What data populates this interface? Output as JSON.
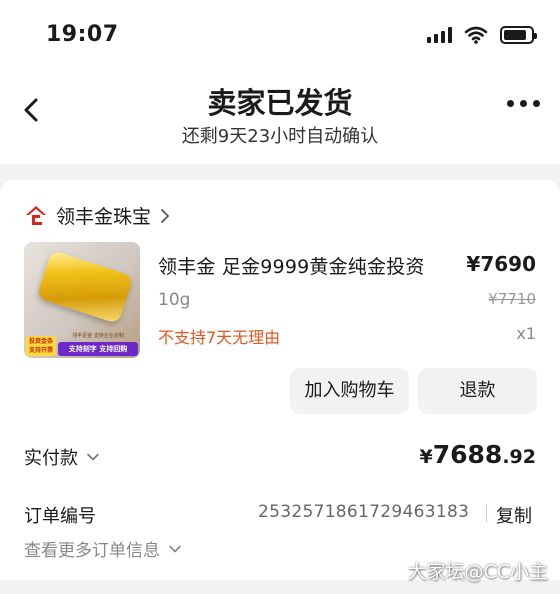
{
  "status_bar": {
    "time": "19:07",
    "battery_level": 0.85
  },
  "nav": {
    "title": "卖家已发货",
    "subtitle": "还剩9天23小时自动确认"
  },
  "shop": {
    "logo_text": "企",
    "name": "领丰金珠宝",
    "chevron": "〉",
    "logo_color": "#d7261e"
  },
  "product": {
    "name": "领丰金 足金9999黄金纯金投资",
    "price": "¥7690",
    "spec": "10g",
    "original_price": "¥7710",
    "notice": "不支持7天无理由",
    "quantity": "x1",
    "thumb_tag_1": "投资金条\n支持开票",
    "thumb_tag_2_top": "翎丰足金 支持企业定制",
    "thumb_tag_2": "支持刻字 支持回购"
  },
  "actions": {
    "add_to_cart": "加入购物车",
    "refund": "退款"
  },
  "payment": {
    "label": "实付款",
    "symbol": "¥",
    "amount_int": "7688",
    "amount_dec": ".92"
  },
  "order": {
    "label": "订单编号",
    "number": "2532571861729463183",
    "copy": "复制",
    "more_info": "查看更多订单信息"
  },
  "watermark": "大家坛@CC小主",
  "colors": {
    "warning": "#e2581f",
    "button_bg": "#f2f2f2",
    "page_bg": "#f2f2f2"
  },
  "icons": [
    "back-icon",
    "more-icon",
    "signal-icon",
    "wifi-icon",
    "battery-icon",
    "shop-logo-icon",
    "chevron-down-icon"
  ]
}
